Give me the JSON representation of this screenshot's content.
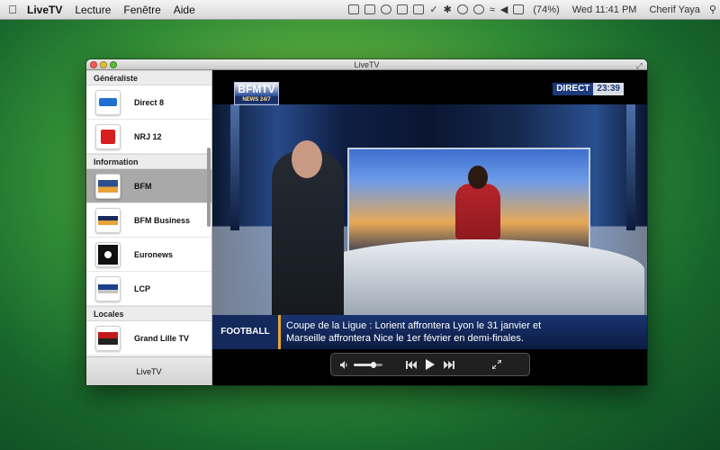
{
  "menubar": {
    "app_name": "LiveTV",
    "menus": [
      "Lecture",
      "Fenêtre",
      "Aide"
    ],
    "battery": "(74%)",
    "clock": "Wed 11:41 PM",
    "user": "Cherif Yaya"
  },
  "window": {
    "title": "LiveTV"
  },
  "sidebar": {
    "groups": [
      {
        "name": "Généraliste"
      },
      {
        "name": "Information"
      },
      {
        "name": "Locales"
      }
    ],
    "channels": [
      {
        "name": "Direct 8",
        "logo": "direct8-logo",
        "selected": false
      },
      {
        "name": "NRJ 12",
        "logo": "nrj12-logo",
        "selected": false
      },
      {
        "name": "BFM",
        "logo": "bfm-logo",
        "selected": true
      },
      {
        "name": "BFM Business",
        "logo": "bfm-business-logo",
        "selected": false
      },
      {
        "name": "Euronews",
        "logo": "euronews-logo",
        "selected": false
      },
      {
        "name": "LCP",
        "logo": "lcp-logo",
        "selected": false
      },
      {
        "name": "Grand Lille TV",
        "logo": "grand-lille-tv-logo",
        "selected": false
      }
    ],
    "footer_label": "LiveTV"
  },
  "player": {
    "channel_logo": "BFMTV",
    "channel_logo_sub": "NEWS 24/7",
    "live_badge": "DIRECT",
    "live_time": "23:39",
    "ticker_category": "FOOTBALL",
    "ticker_line1": "Coupe de la Ligue : Lorient affrontera Lyon le 31 janvier et",
    "ticker_line2": "Marseille affrontera Nice le 1er février en demi-finales.",
    "volume": 0.7
  },
  "colors": {
    "selected_row": "#a9a9a9",
    "ticker_blue": "#1a3470",
    "ticker_accent": "#e9a62e"
  }
}
